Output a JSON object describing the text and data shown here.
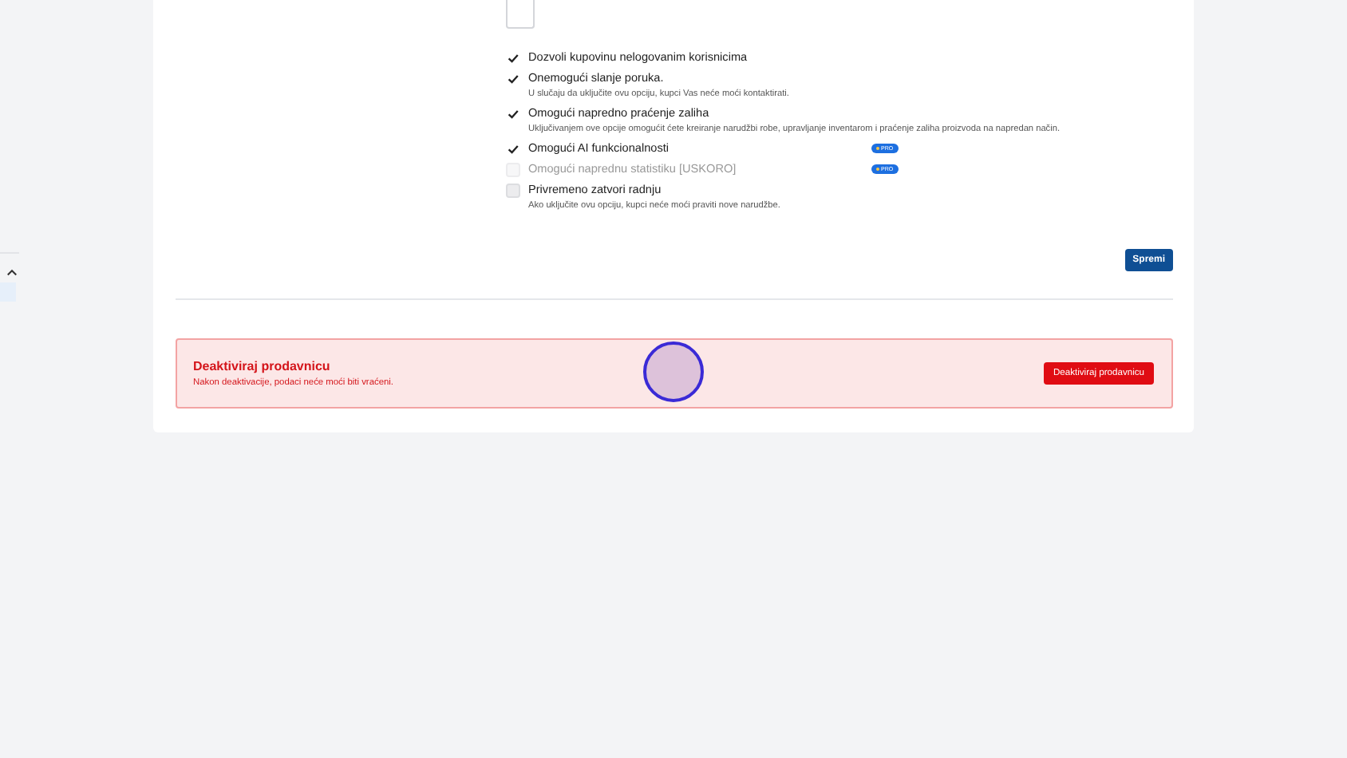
{
  "options": [
    {
      "label": "Dozvoli kupovinu nelogovanim korisnicima",
      "checked": true,
      "disabled": false
    },
    {
      "label": "Onemogući slanje poruka.",
      "hint": "U slučaju da uključite ovu opciju, kupci Vas neće moći kontaktirati.",
      "checked": true,
      "disabled": false
    },
    {
      "label": "Omogući napredno praćenje zaliha",
      "hint": "Uključivanjem ove opcije omogućit ćete kreiranje narudžbi robe, upravljanje inventarom i praćenje zaliha proizvoda na napredan način.",
      "checked": true,
      "disabled": false
    },
    {
      "label": "Omogući AI funkcionalnosti",
      "badge": "PRO",
      "checked": true,
      "disabled": false
    },
    {
      "label": "Omogući naprednu statistiku [USKORO]",
      "badge": "PRO",
      "checked": false,
      "disabled": true
    },
    {
      "label": "Privremeno zatvori radnju",
      "hint": "Ako uključite ovu opciju, kupci neće moći praviti nove narudžbe.",
      "checked": false,
      "disabled": false
    }
  ],
  "save_button": "Spremi",
  "danger": {
    "title": "Deaktiviraj prodavnicu",
    "text": "Nakon deaktivacije, podaci neće moći biti vraćeni.",
    "button": "Deaktiviraj prodavnicu"
  }
}
